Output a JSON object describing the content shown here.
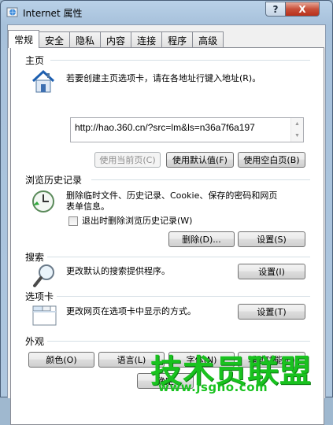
{
  "window": {
    "title": "Internet 属性",
    "help_label": "?",
    "close_label": "X"
  },
  "tabs": [
    {
      "label": "常规",
      "active": true
    },
    {
      "label": "安全"
    },
    {
      "label": "隐私"
    },
    {
      "label": "内容"
    },
    {
      "label": "连接"
    },
    {
      "label": "程序"
    },
    {
      "label": "高级"
    }
  ],
  "homepage": {
    "title": "主页",
    "description": "若要创建主页选项卡，请在各地址行键入地址(R)。",
    "url": "http://hao.360.cn/?src=lm&ls=n36a7f6a197",
    "use_current": "使用当前页(C)",
    "use_default": "使用默认值(F)",
    "use_blank": "使用空白页(B)"
  },
  "history": {
    "title": "浏览历史记录",
    "description_line1": "删除临时文件、历史记录、Cookie、保存的密码和网页",
    "description_line2": "表单信息。",
    "checkbox_label": "退出时删除浏览历史记录(W)",
    "delete_button": "删除(D)...",
    "settings_button": "设置(S)"
  },
  "search": {
    "title": "搜索",
    "description": "更改默认的搜索提供程序。",
    "settings_button": "设置(I)"
  },
  "tabs_section": {
    "title": "选项卡",
    "description": "更改网页在选项卡中显示的方式。",
    "settings_button": "设置(T)"
  },
  "appearance": {
    "title": "外观",
    "colors_button": "颜色(O)",
    "languages_button": "语言(L)",
    "fonts_button": "字体(N)",
    "accessibility_button": "辅助功能(E)"
  },
  "footer": {
    "ok_button": "确定"
  },
  "watermark": {
    "main": "技术员联盟",
    "sub": "www.jsgho.com"
  }
}
